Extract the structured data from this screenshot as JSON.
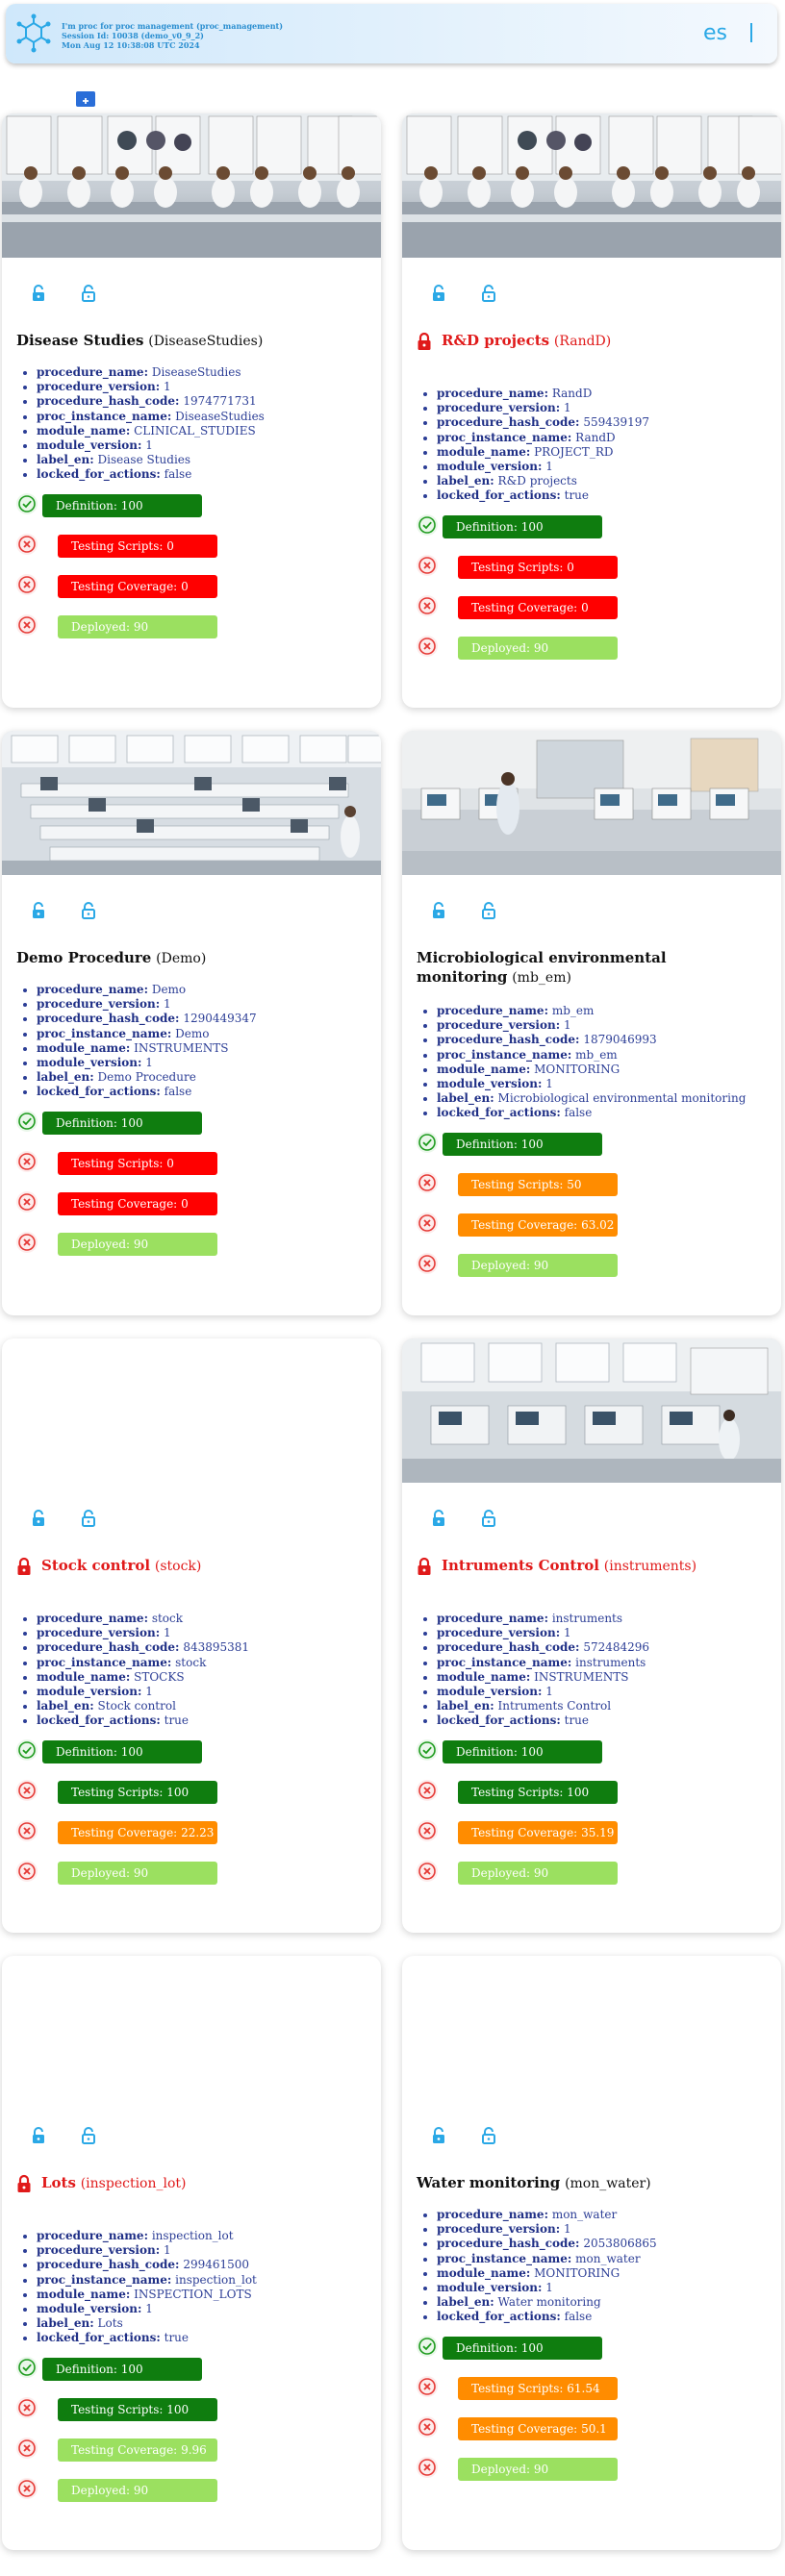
{
  "header": {
    "line1": "I'm proc for proc management (proc_management)",
    "line2": "Session Id: 10038 (demo_v0_9_2)",
    "line3": "Mon Aug 12 10:38:08 UTC 2024",
    "lang": "es"
  },
  "labels": {
    "procedure_name": "procedure_name:",
    "procedure_version": "procedure_version:",
    "procedure_hash_code": "procedure_hash_code:",
    "proc_instance_name": "proc_instance_name:",
    "module_name": "module_name:",
    "module_version": "module_version:",
    "label_en": "label_en:",
    "locked_for_actions": "locked_for_actions:"
  },
  "stat_labels": {
    "definition": "Definition:",
    "testing_scripts": "Testing Scripts:",
    "testing_coverage": "Testing Coverage:",
    "deployed": "Deployed:"
  },
  "cards": [
    {
      "title": "Disease Studies",
      "code": "(DiseaseStudies)",
      "locked": false,
      "procedure_name": "DiseaseStudies",
      "procedure_version": "1",
      "procedure_hash_code": "1974771731",
      "proc_instance_name": "DiseaseStudies",
      "module_name": "CLINICAL_STUDIES",
      "module_version": "1",
      "label_en": "Disease Studies",
      "locked_for_actions": "false",
      "definition": "100",
      "testing_scripts": "0",
      "testing_coverage": "0",
      "deployed": "90"
    },
    {
      "title": "R&D projects",
      "code": "(RandD)",
      "locked": true,
      "procedure_name": "RandD",
      "procedure_version": "1",
      "procedure_hash_code": "559439197",
      "proc_instance_name": "RandD",
      "module_name": "PROJECT_RD",
      "module_version": "1",
      "label_en": "R&D projects",
      "locked_for_actions": "true",
      "definition": "100",
      "testing_scripts": "0",
      "testing_coverage": "0",
      "deployed": "90"
    },
    {
      "title": "Demo Procedure",
      "code": "(Demo)",
      "locked": false,
      "procedure_name": "Demo",
      "procedure_version": "1",
      "procedure_hash_code": "1290449347",
      "proc_instance_name": "Demo",
      "module_name": "INSTRUMENTS",
      "module_version": "1",
      "label_en": "Demo Procedure",
      "locked_for_actions": "false",
      "definition": "100",
      "testing_scripts": "0",
      "testing_coverage": "0",
      "deployed": "90"
    },
    {
      "title": "Microbiological environmental monitoring",
      "code": "(mb_em)",
      "locked": false,
      "procedure_name": "mb_em",
      "procedure_version": "1",
      "procedure_hash_code": "1879046993",
      "proc_instance_name": "mb_em",
      "module_name": "MONITORING",
      "module_version": "1",
      "label_en": "Microbiological environmental monitoring",
      "locked_for_actions": "false",
      "definition": "100",
      "testing_scripts": "50",
      "testing_coverage": "63.02",
      "deployed": "90"
    },
    {
      "title": "Stock control",
      "code": "(stock)",
      "locked": true,
      "procedure_name": "stock",
      "procedure_version": "1",
      "procedure_hash_code": "843895381",
      "proc_instance_name": "stock",
      "module_name": "STOCKS",
      "module_version": "1",
      "label_en": "Stock control",
      "locked_for_actions": "true",
      "definition": "100",
      "testing_scripts": "100",
      "testing_coverage": "22.23",
      "deployed": "90"
    },
    {
      "title": "Intruments Control",
      "code": "(instruments)",
      "locked": true,
      "procedure_name": "instruments",
      "procedure_version": "1",
      "procedure_hash_code": "572484296",
      "proc_instance_name": "instruments",
      "module_name": "INSTRUMENTS",
      "module_version": "1",
      "label_en": "Intruments Control",
      "locked_for_actions": "true",
      "definition": "100",
      "testing_scripts": "100",
      "testing_coverage": "35.19",
      "deployed": "90"
    },
    {
      "title": "Lots",
      "code": "(inspection_lot)",
      "locked": true,
      "procedure_name": "inspection_lot",
      "procedure_version": "1",
      "procedure_hash_code": "299461500",
      "proc_instance_name": "inspection_lot",
      "module_name": "INSPECTION_LOTS",
      "module_version": "1",
      "label_en": "Lots",
      "locked_for_actions": "true",
      "definition": "100",
      "testing_scripts": "100",
      "testing_coverage": "9.96",
      "deployed": "90"
    },
    {
      "title": "Water monitoring",
      "code": "(mon_water)",
      "locked": false,
      "procedure_name": "mon_water",
      "procedure_version": "1",
      "procedure_hash_code": "2053806865",
      "proc_instance_name": "mon_water",
      "module_name": "MONITORING",
      "module_version": "1",
      "label_en": "Water monitoring",
      "locked_for_actions": "false",
      "definition": "100",
      "testing_scripts": "61.54",
      "testing_coverage": "50.1",
      "deployed": "90"
    }
  ],
  "colors": {
    "accent": "#2aa8e6",
    "green": "#0f7d0f",
    "red": "#ff0000",
    "orange": "#ff8c00",
    "light_green": "#9be060",
    "title_red": "#e01a1a"
  },
  "icons": {
    "logo": "molecule-logo-icon",
    "new": "new-folder-icon",
    "unlock": "unlock-icon",
    "lock": "lock-icon",
    "check": "check-circle-icon",
    "error": "error-circle-icon"
  }
}
